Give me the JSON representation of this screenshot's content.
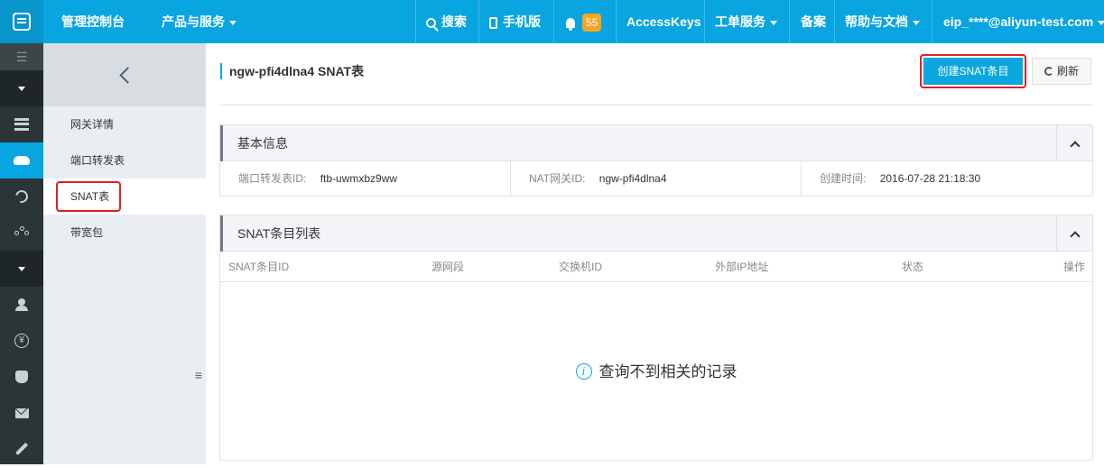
{
  "topbar": {
    "console": "管理控制台",
    "products": "产品与服务",
    "search": "搜索",
    "mobile": "手机版",
    "notifications_count": "55",
    "accesskeys": "AccessKeys",
    "tickets": "工单服务",
    "beian": "备案",
    "help": "帮助与文档",
    "user": "eip_****@aliyun-test.com"
  },
  "rail": {
    "menu_glyph": "☰",
    "yen_glyph": "¥"
  },
  "sidebar": {
    "items": [
      {
        "label": "网关详情"
      },
      {
        "label": "端口转发表"
      },
      {
        "label": "SNAT表"
      },
      {
        "label": "带宽包"
      }
    ]
  },
  "main": {
    "title": "ngw-pfi4dlna4 SNAT表",
    "create_button": "创建SNAT条目",
    "refresh_button": "刷新"
  },
  "basic_info": {
    "title": "基本信息",
    "fields": [
      {
        "label": "端口转发表ID:",
        "value": "ftb-uwmxbz9ww"
      },
      {
        "label": "NAT网关ID:",
        "value": "ngw-pfi4dlna4"
      },
      {
        "label": "创建时间:",
        "value": "2016-07-28 21:18:30"
      }
    ]
  },
  "snat_list": {
    "title": "SNAT条目列表",
    "columns": [
      "SNAT条目ID",
      "源网段",
      "交换机ID",
      "外部IP地址",
      "状态",
      "操作"
    ],
    "empty_text": "查询不到相关的记录"
  },
  "colors": {
    "topbar": "#09a5e0",
    "rail": "#2b3437",
    "sidebar": "#eaedf1",
    "highlight": "#e02020"
  }
}
